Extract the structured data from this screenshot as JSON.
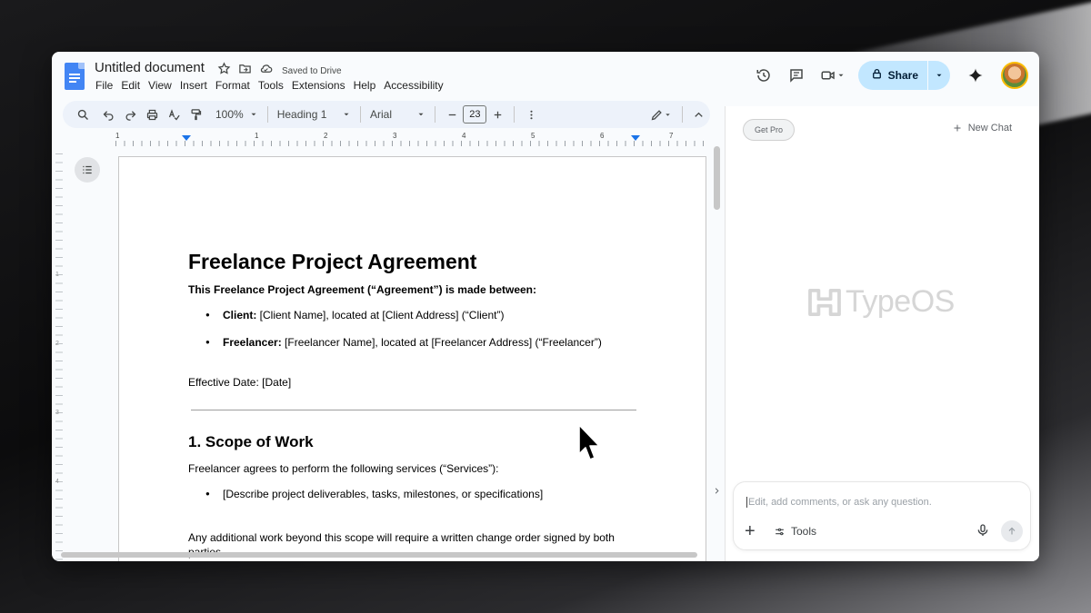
{
  "header": {
    "doc_title": "Untitled document",
    "saved_status": "Saved to Drive",
    "share_label": "Share"
  },
  "menu": [
    "File",
    "Edit",
    "View",
    "Insert",
    "Format",
    "Tools",
    "Extensions",
    "Help",
    "Accessibility"
  ],
  "toolbar": {
    "zoom": "100%",
    "style": "Heading 1",
    "font": "Arial",
    "font_size": "23"
  },
  "ruler": {
    "labels": [
      "1",
      "1",
      "2",
      "3",
      "4",
      "5",
      "6",
      "7"
    ]
  },
  "vruler": {
    "labels": [
      "1",
      "2",
      "3",
      "4"
    ]
  },
  "document": {
    "title": "Freelance Project Agreement",
    "intro": "This Freelance Project Agreement (“Agreement”) is made between:",
    "client_label": "Client:",
    "client_text": " [Client Name], located at [Client Address] (“Client”)",
    "freelancer_label": "Freelancer:",
    "freelancer_text": " [Freelancer Name], located at [Freelancer Address] (“Freelancer”)",
    "effective_date": "Effective Date: [Date]",
    "section1_heading": "1. Scope of Work",
    "section1_intro": "Freelancer agrees to perform the following services (“Services”):",
    "section1_bullet": "[Describe project deliverables, tasks, milestones, or specifications]",
    "section1_note": "Any additional work beyond this scope will require a written change order signed by both parties"
  },
  "sidebar": {
    "get_pro": "Get Pro",
    "new_chat": "New Chat",
    "logo_text": "TypeOS",
    "chat_placeholder": "Edit, add comments, or ask any question.",
    "tools_label": "Tools"
  },
  "colors": {
    "share_bg": "#c2e7ff",
    "docs_blue": "#4285f4",
    "toolbar_bg": "#edf2fa",
    "ruler_marker": "#1a73e8"
  },
  "icons": {
    "header": [
      "docs-logo-icon",
      "star-icon",
      "move-folder-icon",
      "cloud-saved-icon",
      "version-history-icon",
      "comment-icon",
      "meet-video-icon",
      "lock-icon",
      "gemini-sparkle-icon"
    ],
    "toolbar": [
      "search-icon",
      "undo-icon",
      "redo-icon",
      "print-icon",
      "spellcheck-icon",
      "paint-format-icon",
      "more-icon",
      "edit-mode-icon",
      "collapse-icon"
    ]
  }
}
